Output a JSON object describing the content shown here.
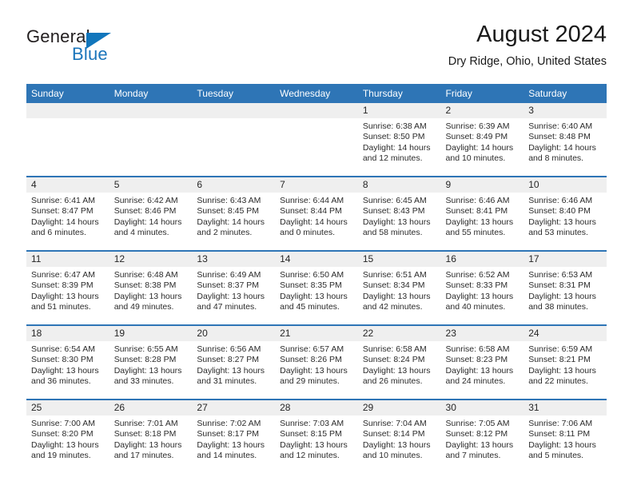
{
  "brand": {
    "name_part1": "General",
    "name_part2": "Blue",
    "triangle_color": "#1176bc",
    "blue_color": "#1b75bb"
  },
  "header": {
    "title": "August 2024",
    "subtitle": "Dry Ridge, Ohio, United States"
  },
  "theme": {
    "header_blue": "#2e75b6",
    "daynum_band": "#efefef",
    "text": "#2b2b2b"
  },
  "labels": {
    "sunrise_prefix": "Sunrise:",
    "sunset_prefix": "Sunset:",
    "daylight_prefix": "Daylight:"
  },
  "weekday_headers": [
    "Sunday",
    "Monday",
    "Tuesday",
    "Wednesday",
    "Thursday",
    "Friday",
    "Saturday"
  ],
  "weeks": [
    [
      {
        "day": "",
        "empty": true
      },
      {
        "day": "",
        "empty": true
      },
      {
        "day": "",
        "empty": true
      },
      {
        "day": "",
        "empty": true
      },
      {
        "day": "1",
        "sunrise": "Sunrise: 6:38 AM",
        "sunset": "Sunset: 8:50 PM",
        "daylight": "Daylight: 14 hours and 12 minutes."
      },
      {
        "day": "2",
        "sunrise": "Sunrise: 6:39 AM",
        "sunset": "Sunset: 8:49 PM",
        "daylight": "Daylight: 14 hours and 10 minutes."
      },
      {
        "day": "3",
        "sunrise": "Sunrise: 6:40 AM",
        "sunset": "Sunset: 8:48 PM",
        "daylight": "Daylight: 14 hours and 8 minutes."
      }
    ],
    [
      {
        "day": "4",
        "sunrise": "Sunrise: 6:41 AM",
        "sunset": "Sunset: 8:47 PM",
        "daylight": "Daylight: 14 hours and 6 minutes."
      },
      {
        "day": "5",
        "sunrise": "Sunrise: 6:42 AM",
        "sunset": "Sunset: 8:46 PM",
        "daylight": "Daylight: 14 hours and 4 minutes."
      },
      {
        "day": "6",
        "sunrise": "Sunrise: 6:43 AM",
        "sunset": "Sunset: 8:45 PM",
        "daylight": "Daylight: 14 hours and 2 minutes."
      },
      {
        "day": "7",
        "sunrise": "Sunrise: 6:44 AM",
        "sunset": "Sunset: 8:44 PM",
        "daylight": "Daylight: 14 hours and 0 minutes."
      },
      {
        "day": "8",
        "sunrise": "Sunrise: 6:45 AM",
        "sunset": "Sunset: 8:43 PM",
        "daylight": "Daylight: 13 hours and 58 minutes."
      },
      {
        "day": "9",
        "sunrise": "Sunrise: 6:46 AM",
        "sunset": "Sunset: 8:41 PM",
        "daylight": "Daylight: 13 hours and 55 minutes."
      },
      {
        "day": "10",
        "sunrise": "Sunrise: 6:46 AM",
        "sunset": "Sunset: 8:40 PM",
        "daylight": "Daylight: 13 hours and 53 minutes."
      }
    ],
    [
      {
        "day": "11",
        "sunrise": "Sunrise: 6:47 AM",
        "sunset": "Sunset: 8:39 PM",
        "daylight": "Daylight: 13 hours and 51 minutes."
      },
      {
        "day": "12",
        "sunrise": "Sunrise: 6:48 AM",
        "sunset": "Sunset: 8:38 PM",
        "daylight": "Daylight: 13 hours and 49 minutes."
      },
      {
        "day": "13",
        "sunrise": "Sunrise: 6:49 AM",
        "sunset": "Sunset: 8:37 PM",
        "daylight": "Daylight: 13 hours and 47 minutes."
      },
      {
        "day": "14",
        "sunrise": "Sunrise: 6:50 AM",
        "sunset": "Sunset: 8:35 PM",
        "daylight": "Daylight: 13 hours and 45 minutes."
      },
      {
        "day": "15",
        "sunrise": "Sunrise: 6:51 AM",
        "sunset": "Sunset: 8:34 PM",
        "daylight": "Daylight: 13 hours and 42 minutes."
      },
      {
        "day": "16",
        "sunrise": "Sunrise: 6:52 AM",
        "sunset": "Sunset: 8:33 PM",
        "daylight": "Daylight: 13 hours and 40 minutes."
      },
      {
        "day": "17",
        "sunrise": "Sunrise: 6:53 AM",
        "sunset": "Sunset: 8:31 PM",
        "daylight": "Daylight: 13 hours and 38 minutes."
      }
    ],
    [
      {
        "day": "18",
        "sunrise": "Sunrise: 6:54 AM",
        "sunset": "Sunset: 8:30 PM",
        "daylight": "Daylight: 13 hours and 36 minutes."
      },
      {
        "day": "19",
        "sunrise": "Sunrise: 6:55 AM",
        "sunset": "Sunset: 8:28 PM",
        "daylight": "Daylight: 13 hours and 33 minutes."
      },
      {
        "day": "20",
        "sunrise": "Sunrise: 6:56 AM",
        "sunset": "Sunset: 8:27 PM",
        "daylight": "Daylight: 13 hours and 31 minutes."
      },
      {
        "day": "21",
        "sunrise": "Sunrise: 6:57 AM",
        "sunset": "Sunset: 8:26 PM",
        "daylight": "Daylight: 13 hours and 29 minutes."
      },
      {
        "day": "22",
        "sunrise": "Sunrise: 6:58 AM",
        "sunset": "Sunset: 8:24 PM",
        "daylight": "Daylight: 13 hours and 26 minutes."
      },
      {
        "day": "23",
        "sunrise": "Sunrise: 6:58 AM",
        "sunset": "Sunset: 8:23 PM",
        "daylight": "Daylight: 13 hours and 24 minutes."
      },
      {
        "day": "24",
        "sunrise": "Sunrise: 6:59 AM",
        "sunset": "Sunset: 8:21 PM",
        "daylight": "Daylight: 13 hours and 22 minutes."
      }
    ],
    [
      {
        "day": "25",
        "sunrise": "Sunrise: 7:00 AM",
        "sunset": "Sunset: 8:20 PM",
        "daylight": "Daylight: 13 hours and 19 minutes."
      },
      {
        "day": "26",
        "sunrise": "Sunrise: 7:01 AM",
        "sunset": "Sunset: 8:18 PM",
        "daylight": "Daylight: 13 hours and 17 minutes."
      },
      {
        "day": "27",
        "sunrise": "Sunrise: 7:02 AM",
        "sunset": "Sunset: 8:17 PM",
        "daylight": "Daylight: 13 hours and 14 minutes."
      },
      {
        "day": "28",
        "sunrise": "Sunrise: 7:03 AM",
        "sunset": "Sunset: 8:15 PM",
        "daylight": "Daylight: 13 hours and 12 minutes."
      },
      {
        "day": "29",
        "sunrise": "Sunrise: 7:04 AM",
        "sunset": "Sunset: 8:14 PM",
        "daylight": "Daylight: 13 hours and 10 minutes."
      },
      {
        "day": "30",
        "sunrise": "Sunrise: 7:05 AM",
        "sunset": "Sunset: 8:12 PM",
        "daylight": "Daylight: 13 hours and 7 minutes."
      },
      {
        "day": "31",
        "sunrise": "Sunrise: 7:06 AM",
        "sunset": "Sunset: 8:11 PM",
        "daylight": "Daylight: 13 hours and 5 minutes."
      }
    ]
  ]
}
